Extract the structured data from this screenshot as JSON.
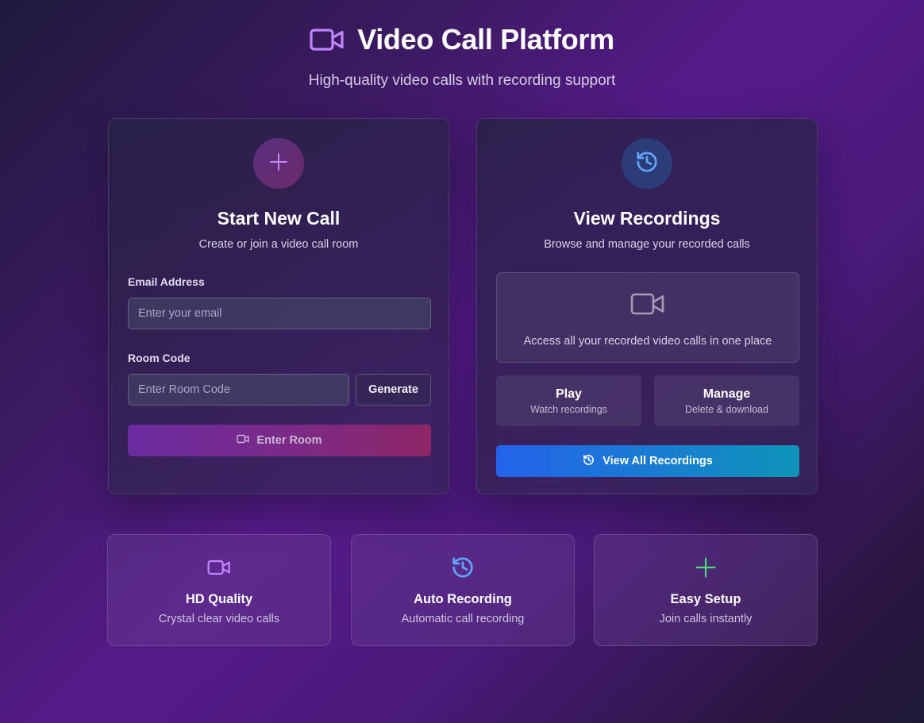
{
  "header": {
    "title": "Video Call Platform",
    "subtitle": "High-quality video calls with recording support"
  },
  "start_card": {
    "title": "Start New Call",
    "description": "Create or join a video call room",
    "email_label": "Email Address",
    "email_placeholder": "Enter your email",
    "email_value": "",
    "room_label": "Room Code",
    "room_placeholder": "Enter Room Code",
    "room_value": "",
    "generate_label": "Generate",
    "enter_label": "Enter Room"
  },
  "recordings_card": {
    "title": "View Recordings",
    "description": "Browse and manage your recorded calls",
    "access_text": "Access all your recorded video calls in one place",
    "play_title": "Play",
    "play_sub": "Watch recordings",
    "manage_title": "Manage",
    "manage_sub": "Delete & download",
    "view_all_label": "View All Recordings"
  },
  "features": [
    {
      "title": "HD Quality",
      "description": "Crystal clear video calls",
      "icon": "video-icon"
    },
    {
      "title": "Auto Recording",
      "description": "Automatic call recording",
      "icon": "history-icon"
    },
    {
      "title": "Easy Setup",
      "description": "Join calls instantly",
      "icon": "plus-icon"
    }
  ],
  "colors": {
    "accent_purple": "#c084fc",
    "accent_blue": "#60a5fa",
    "accent_green": "#4ade80",
    "enter_gradient_start": "#6a2b9f",
    "enter_gradient_end": "#8e2666",
    "view_all_gradient_start": "#2563eb",
    "view_all_gradient_end": "#0d94b8"
  }
}
